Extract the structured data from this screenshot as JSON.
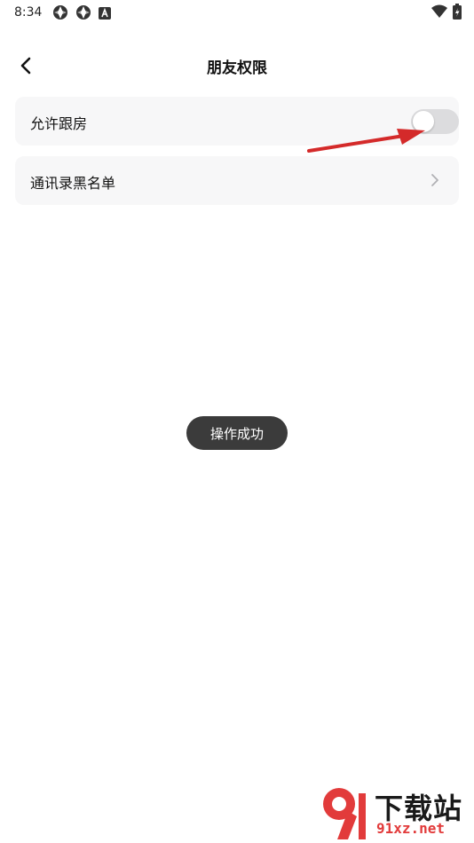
{
  "status_bar": {
    "time": "8:34",
    "left_icons": [
      "aperture-icon",
      "aperture-icon",
      "a-app-icon"
    ],
    "right_icons": [
      "wifi-icon",
      "battery-icon"
    ]
  },
  "nav": {
    "back_icon": "chevron-left-icon",
    "title": "朋友权限"
  },
  "settings": {
    "allow_follow": {
      "label": "允许跟房",
      "toggle_on": false
    },
    "blacklist": {
      "label": "通讯录黑名单",
      "icon": "chevron-right-icon"
    }
  },
  "toast": {
    "text": "操作成功"
  },
  "colors": {
    "background": "#ffffff",
    "card_background": "#f7f7f8",
    "toggle_off": "#dcdcde",
    "annotation_arrow": "#d42a2a",
    "toast_background": "#3b3b3b"
  },
  "watermark": {
    "title": "下载站",
    "url": "91xz.net"
  }
}
